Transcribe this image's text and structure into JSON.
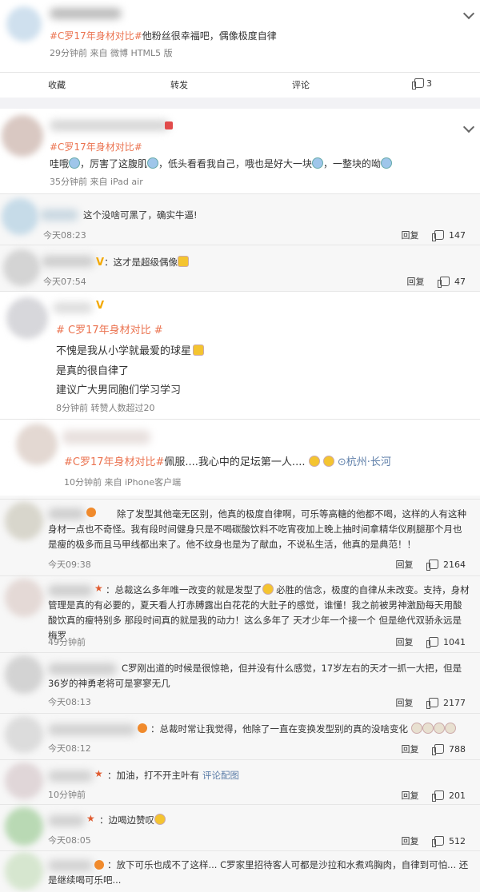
{
  "post1": {
    "hashtag": "#C罗17年身材对比#",
    "text": "他粉丝很幸福吧，偶像极度自律",
    "meta": "29分钟前  来自 微博 HTML5 版",
    "actions": {
      "fav": "收藏",
      "repost": "转发",
      "comment": "评论",
      "like_count": "3"
    }
  },
  "post2": {
    "hashtag": "#C罗17年身材对比#",
    "text_a": "哇哦",
    "text_b": "，厉害了这腹肌",
    "text_c": "，低头看看我自己，哦也是好大一块",
    "text_d": "，一整块的呦",
    "meta": "35分钟前  来自 iPad air"
  },
  "reply1": {
    "text": "这个没啥可黑了，确实牛逼!",
    "time": "今天08:23",
    "reply": "回复",
    "likes": "147"
  },
  "reply2": {
    "text": "：这才是超级偶像",
    "time": "今天07:54",
    "reply": "回复",
    "likes": "47"
  },
  "post3": {
    "hashtag": "# C罗17年身材对比 #",
    "line1": "不愧是我从小学就最爱的球星",
    "line2": "是真的很自律了",
    "line3": "建议广大男同胞们学习学习",
    "meta": "8分钟前  转赞人数超过20"
  },
  "post4": {
    "hashtag": "#C罗17年身材对比#",
    "text": "佩服....我心中的足坛第一人....",
    "location": "杭州·长河",
    "meta": "10分钟前  来自 iPhone客户端"
  },
  "comments": [
    {
      "text": "除了发型其他毫无区别，他真的极度自律啊，可乐等高糖的他都不喝，这样的人有这种身材一点也不奇怪。我有段时间健身只是不喝碳酸饮料不吃宵夜加上晚上抽时间拿精华仪刷腿那个月也是瘦的极多而且马甲线都出来了。他不纹身也是为了献血，不说私生活，他真的是典范！！",
      "time": "今天09:38",
      "reply": "回复",
      "likes": "2164"
    },
    {
      "text_a": "：总裁这么多年唯一改变的就是发型了",
      "text_b": " 必胜的信念，极度的自律从未改变。支持，身材管理是真的有必要的，夏天看人打赤膊露出白花花的大肚子的感觉，谁懂！我之前被男神激励每天用酸酸饮真的瘦特别多 那段时间真的就是我的动力！这么多年了 天才少年一个接一个 但是绝代双骄永远是梅罗",
      "time": "49分钟前",
      "reply": "回复",
      "likes": "1041"
    },
    {
      "text": "C罗刚出道的时候是很惊艳，但并没有什么感觉，17岁左右的天才一抓一大把，但是36岁的神勇老将可是寥寥无几",
      "time": "今天08:13",
      "reply": "回复",
      "likes": "2177"
    },
    {
      "text": "：总裁时常让我觉得，他除了一直在变换发型别的真的没啥变化",
      "time": "今天08:12",
      "reply": "回复",
      "likes": "788"
    },
    {
      "text": "：加油，打不开主叶有",
      "link": "评论配图",
      "time": "10分钟前",
      "reply": "回复",
      "likes": "201"
    },
    {
      "text": "：边喝边赞叹",
      "time": "今天08:05",
      "reply": "回复",
      "likes": "512"
    },
    {
      "text": "：放下可乐也成不了这样... C罗家里招待客人可都是沙拉和水煮鸡胸肉，自律到可怕... 还是继续喝可乐吧..."
    }
  ],
  "colors": {
    "hashtag": "#eb7350",
    "link": "#5d7ea8",
    "separator": "#f2f2f5"
  }
}
